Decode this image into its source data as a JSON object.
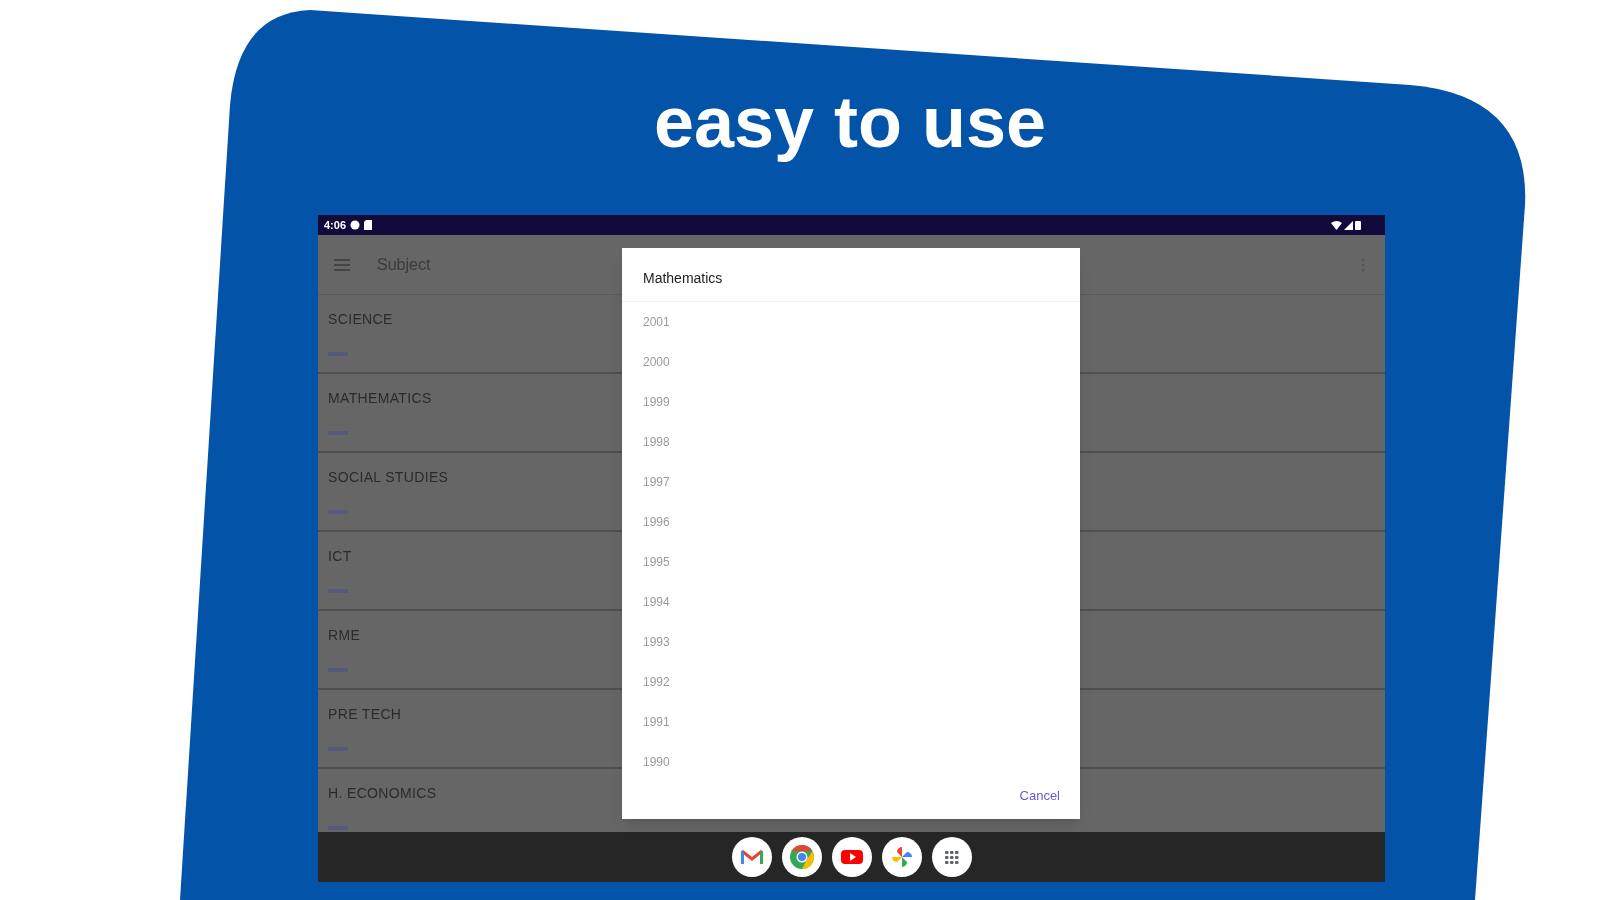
{
  "headline": "easy to use",
  "status_bar": {
    "time": "4:06"
  },
  "app_bar": {
    "title": "Subject"
  },
  "subjects": [
    {
      "name": "SCIENCE"
    },
    {
      "name": "MATHEMATICS"
    },
    {
      "name": "SOCIAL STUDIES"
    },
    {
      "name": "ICT"
    },
    {
      "name": "RME"
    },
    {
      "name": "PRE TECH"
    },
    {
      "name": "H. ECONOMICS"
    }
  ],
  "dialog": {
    "title": "Mathematics",
    "years": [
      "2001",
      "2000",
      "1999",
      "1998",
      "1997",
      "1996",
      "1995",
      "1994",
      "1993",
      "1992",
      "1991",
      "1990"
    ],
    "cancel": "Cancel"
  },
  "dock": [
    {
      "kind": "mail"
    },
    {
      "kind": "browser"
    },
    {
      "kind": "video"
    },
    {
      "kind": "photos"
    },
    {
      "kind": "apps"
    }
  ]
}
